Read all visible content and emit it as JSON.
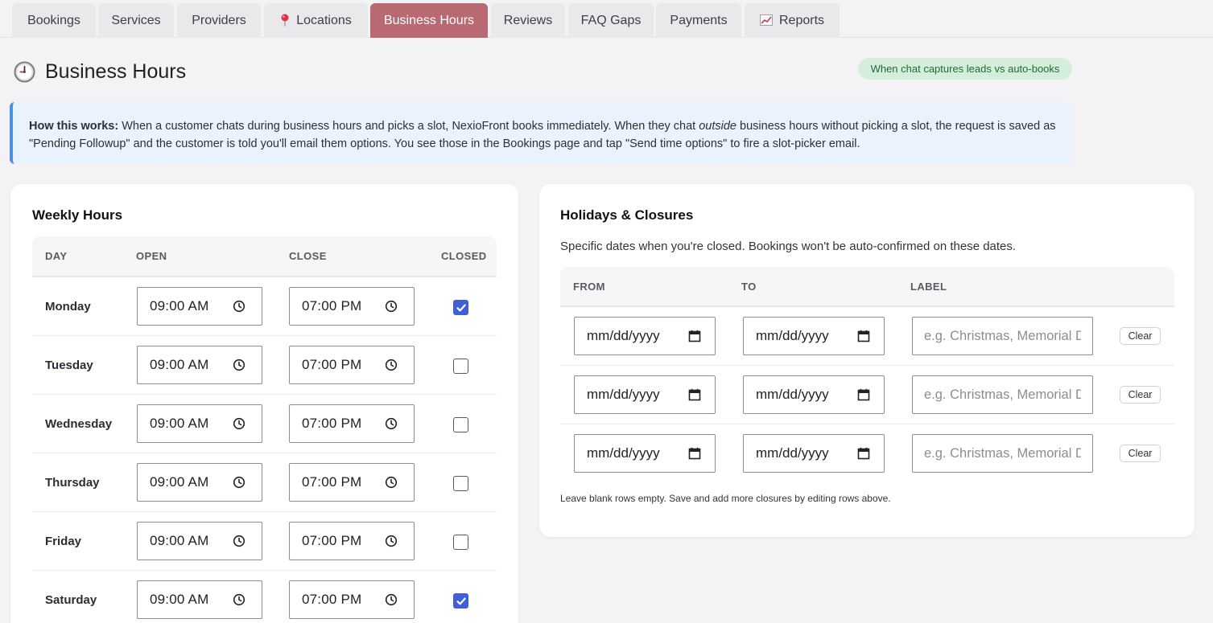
{
  "tabs": [
    {
      "label": "Bookings",
      "icon": ""
    },
    {
      "label": "Services",
      "icon": ""
    },
    {
      "label": "Providers",
      "icon": ""
    },
    {
      "label": "Locations",
      "icon": "pin-icon"
    },
    {
      "label": "Business Hours",
      "icon": "",
      "active": true
    },
    {
      "label": "Reviews",
      "icon": ""
    },
    {
      "label": "FAQ Gaps",
      "icon": ""
    },
    {
      "label": "Payments",
      "icon": ""
    },
    {
      "label": "Reports",
      "icon": "chart-icon"
    }
  ],
  "header": {
    "title": "Business Hours",
    "icon": "clock-icon",
    "badge": "When chat captures leads vs auto-books"
  },
  "info": {
    "lead": "How this works:",
    "part1": " When a customer chats during business hours and picks a slot, NexioFront books immediately. When they chat ",
    "emph": "outside",
    "part2": " business hours without picking a slot, the request is saved as \"Pending Followup\" and the customer is told you'll email them options. You see those in the Bookings page and tap \"Send time options\" to fire a slot-picker email."
  },
  "weekly": {
    "title": "Weekly Hours",
    "columns": {
      "day": "DAY",
      "open": "OPEN",
      "close": "CLOSE",
      "closed": "CLOSED"
    },
    "rows": [
      {
        "day": "Monday",
        "open": "09:00 AM",
        "close": "07:00 PM",
        "closed": true
      },
      {
        "day": "Tuesday",
        "open": "09:00 AM",
        "close": "07:00 PM",
        "closed": false
      },
      {
        "day": "Wednesday",
        "open": "09:00 AM",
        "close": "07:00 PM",
        "closed": false
      },
      {
        "day": "Thursday",
        "open": "09:00 AM",
        "close": "07:00 PM",
        "closed": false
      },
      {
        "day": "Friday",
        "open": "09:00 AM",
        "close": "07:00 PM",
        "closed": false
      },
      {
        "day": "Saturday",
        "open": "09:00 AM",
        "close": "07:00 PM",
        "closed": true
      }
    ]
  },
  "holidays": {
    "title": "Holidays & Closures",
    "description": "Specific dates when you're closed. Bookings won't be auto-confirmed on these dates.",
    "columns": {
      "from": "FROM",
      "to": "TO",
      "label": "LABEL"
    },
    "date_placeholder": "mm/dd/yyyy",
    "label_placeholder": "e.g. Christmas, Memorial Day",
    "clear_label": "Clear",
    "footnote": "Leave blank rows empty. Save and add more closures by editing rows above."
  },
  "colors": {
    "active_tab": "#b86972",
    "badge_bg": "#d5eedc",
    "badge_text": "#1d6b38",
    "info_border": "#4a8fe0",
    "checkbox_on": "#3f5fd6"
  }
}
